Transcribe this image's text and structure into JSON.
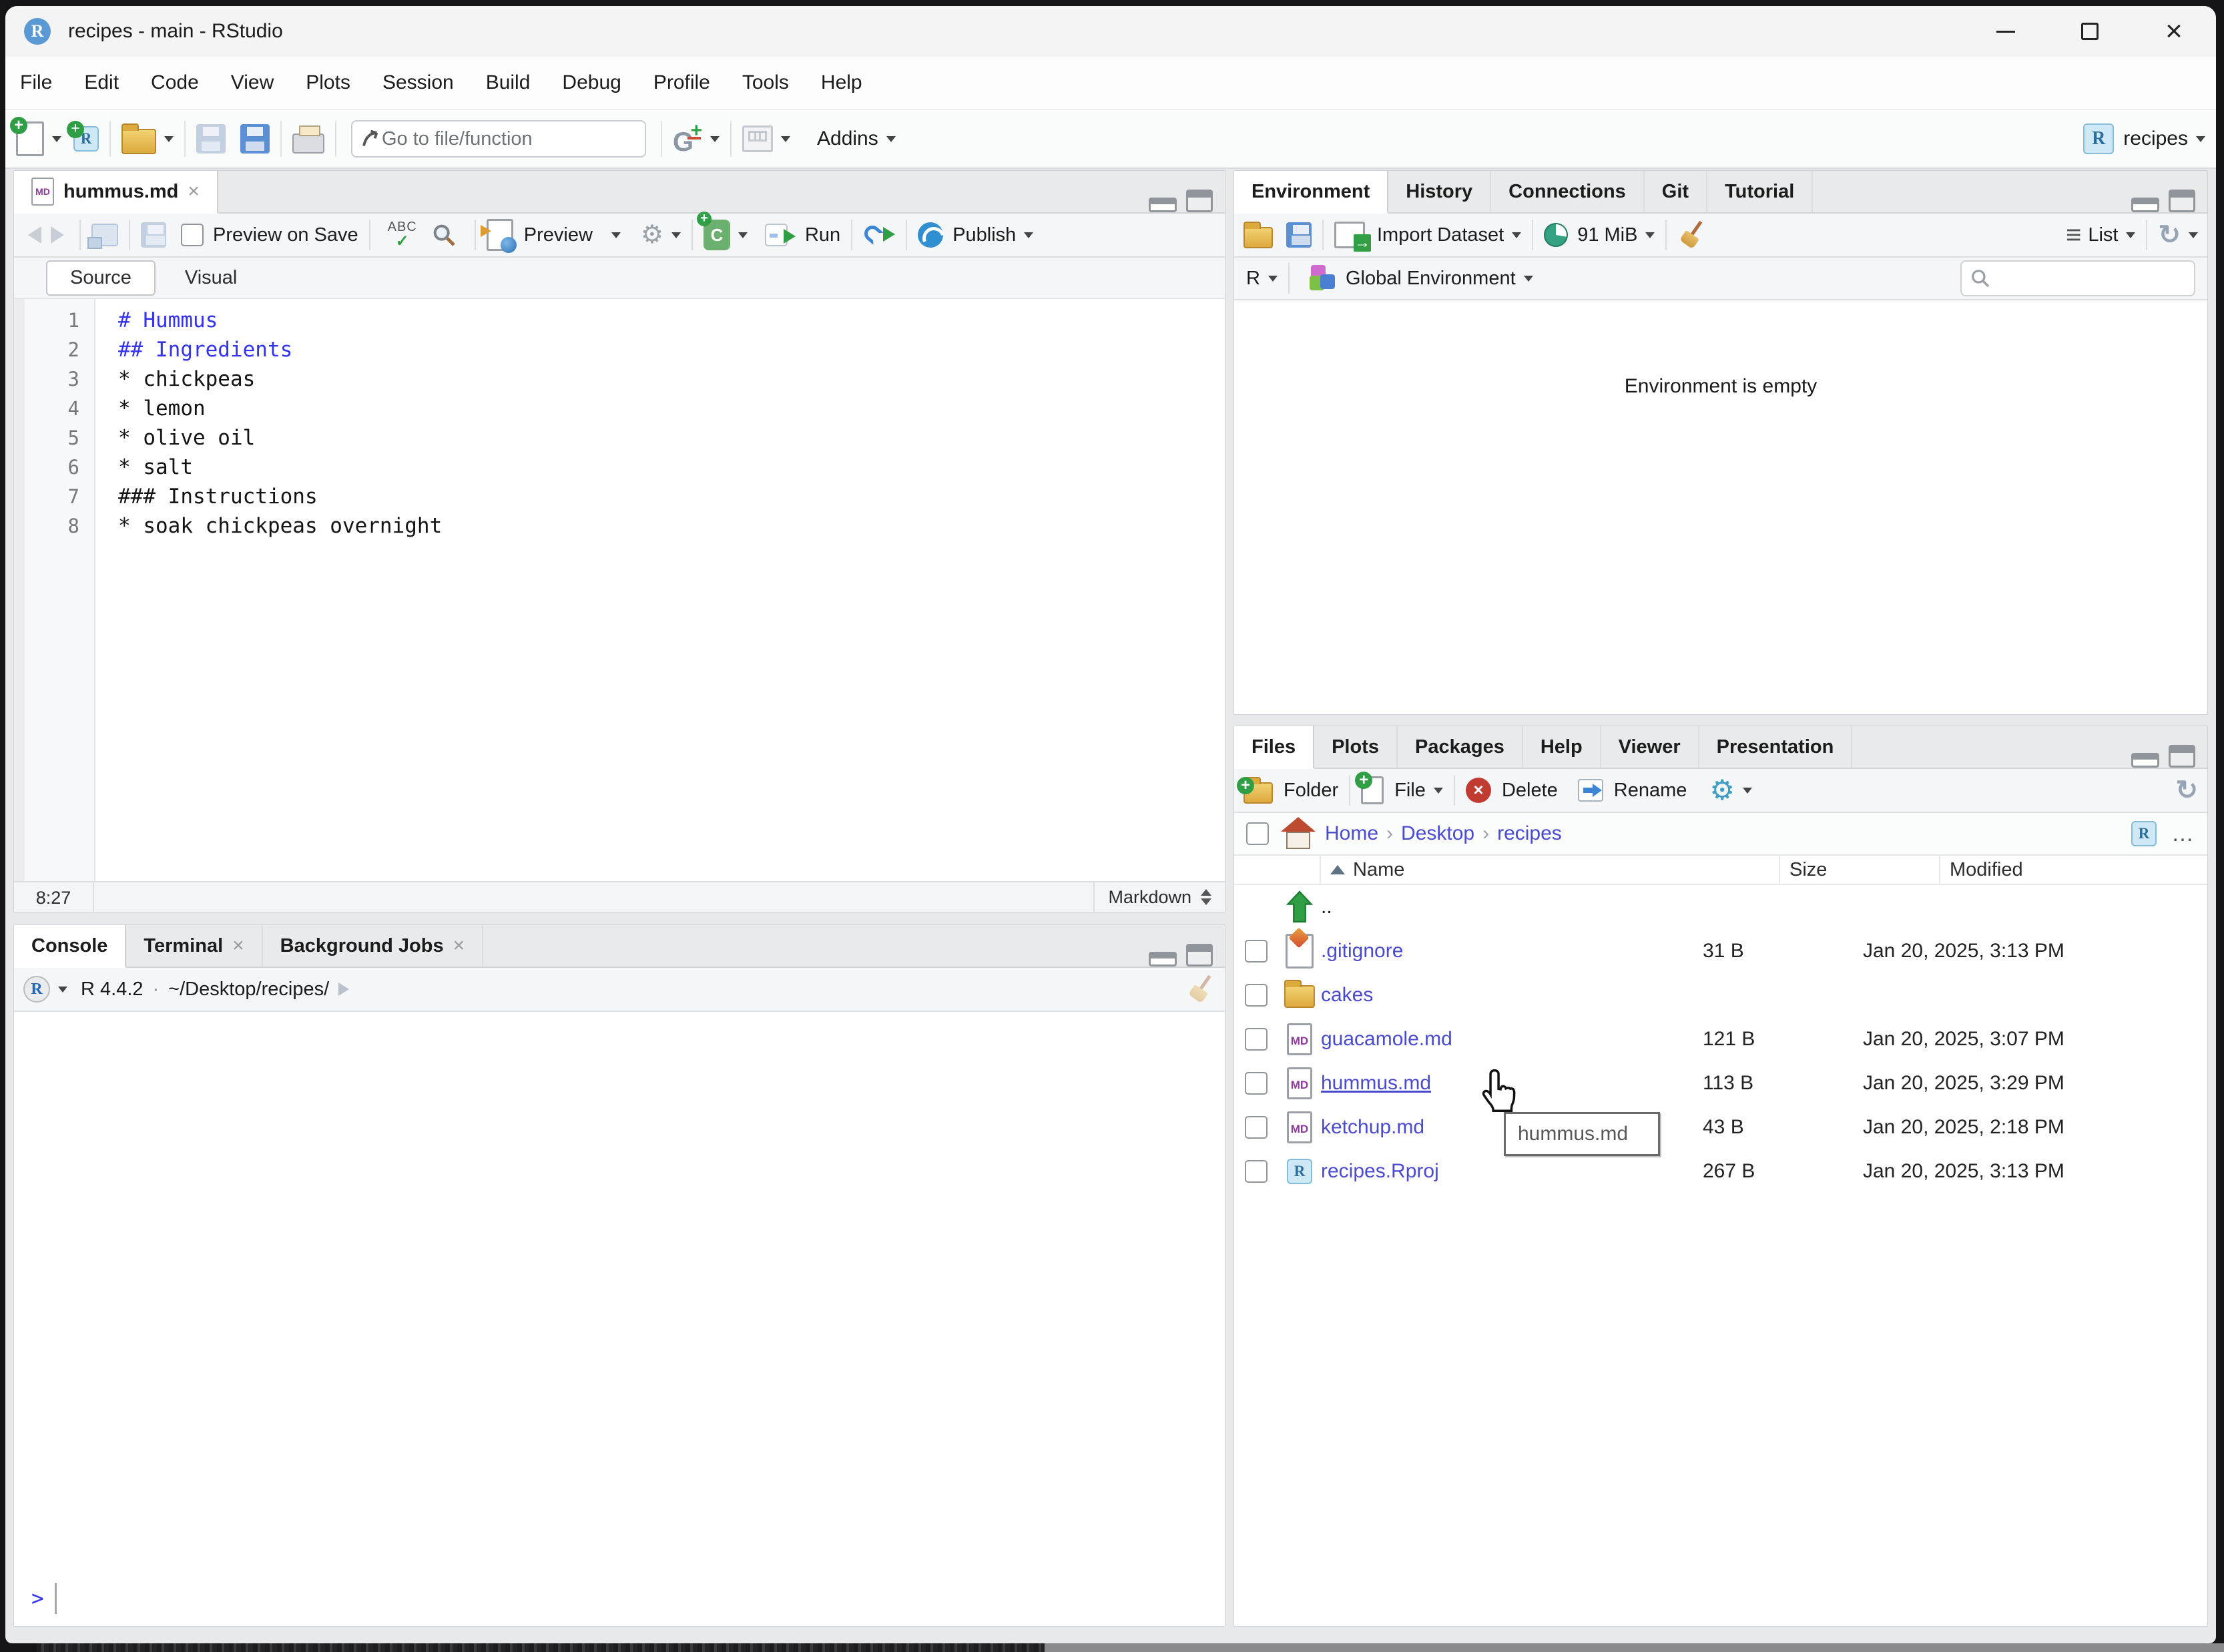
{
  "window": {
    "title": "recipes - main - RStudio"
  },
  "menu": {
    "items": [
      "File",
      "Edit",
      "Code",
      "View",
      "Plots",
      "Session",
      "Build",
      "Debug",
      "Profile",
      "Tools",
      "Help"
    ]
  },
  "toolbar": {
    "goto_placeholder": "Go to file/function",
    "addins_label": "Addins",
    "project_label": "recipes"
  },
  "editor": {
    "tab_title": "hummus.md",
    "preview_on_save": "Preview on Save",
    "preview_label": "Preview",
    "run_label": "Run",
    "publish_label": "Publish",
    "source_label": "Source",
    "visual_label": "Visual",
    "status_position": "8:27",
    "status_mode": "Markdown",
    "lines": [
      {
        "num": "1",
        "text": "# Hummus"
      },
      {
        "num": "2",
        "text": "## Ingredients"
      },
      {
        "num": "3",
        "text": "* chickpeas"
      },
      {
        "num": "4",
        "text": "* lemon"
      },
      {
        "num": "5",
        "text": "* olive oil"
      },
      {
        "num": "6",
        "text": "* salt"
      },
      {
        "num": "7",
        "text": "### Instructions"
      },
      {
        "num": "8",
        "text": "* soak chickpeas overnight"
      }
    ]
  },
  "environment": {
    "tabs": [
      "Environment",
      "History",
      "Connections",
      "Git",
      "Tutorial"
    ],
    "import_label": "Import Dataset",
    "memory": "91 MiB",
    "list_label": "List",
    "r_selector": "R",
    "scope_label": "Global Environment",
    "empty_text": "Environment is empty"
  },
  "console": {
    "tabs": [
      "Console",
      "Terminal",
      "Background Jobs"
    ],
    "r_version": "R 4.4.2",
    "dot": "·",
    "cwd": "~/Desktop/recipes/",
    "prompt": ">"
  },
  "files": {
    "tabs": [
      "Files",
      "Plots",
      "Packages",
      "Help",
      "Viewer",
      "Presentation"
    ],
    "toolbar": {
      "folder": "Folder",
      "file": "File",
      "delete": "Delete",
      "rename": "Rename"
    },
    "breadcrumb": [
      "Home",
      "Desktop",
      "recipes"
    ],
    "columns": [
      "Name",
      "Size",
      "Modified"
    ],
    "rows": [
      {
        "name": "..",
        "size": "",
        "modified": ""
      },
      {
        "name": ".gitignore",
        "size": "31 B",
        "modified": "Jan 20, 2025, 3:13 PM"
      },
      {
        "name": "cakes",
        "size": "",
        "modified": ""
      },
      {
        "name": "guacamole.md",
        "size": "121 B",
        "modified": "Jan 20, 2025, 3:07 PM"
      },
      {
        "name": "hummus.md",
        "size": "113 B",
        "modified": "Jan 20, 2025, 3:29 PM"
      },
      {
        "name": "ketchup.md",
        "size": "43 B",
        "modified": "Jan 20, 2025, 2:18 PM"
      },
      {
        "name": "recipes.Rproj",
        "size": "267 B",
        "modified": "Jan 20, 2025, 3:13 PM"
      }
    ],
    "tooltip": "hummus.md"
  }
}
